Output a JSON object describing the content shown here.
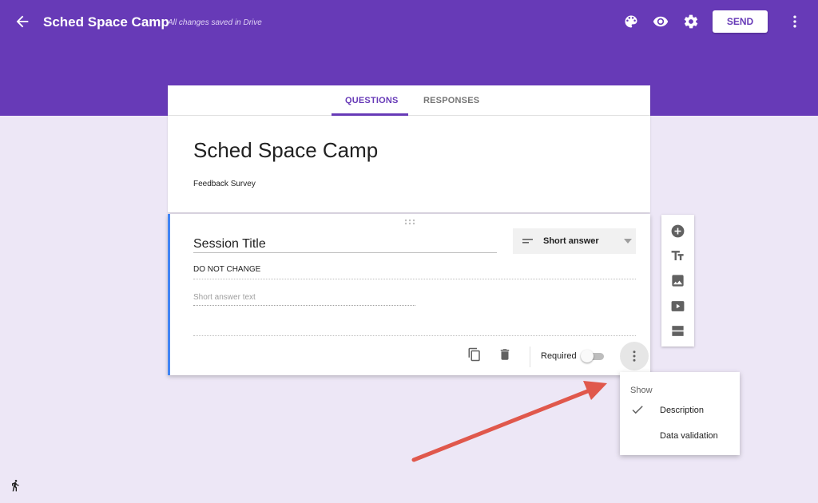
{
  "app": {
    "title": "Sched Space Camp",
    "save_status": "All changes saved in Drive",
    "send_label": "SEND"
  },
  "icons": {
    "back": "arrow-back-icon",
    "palette": "palette-icon",
    "preview": "eye-icon",
    "settings": "gear-icon",
    "more": "more-vert-icon"
  },
  "tabs": [
    {
      "label": "QUESTIONS",
      "active": true
    },
    {
      "label": "RESPONSES",
      "active": false
    }
  ],
  "form": {
    "title": "Sched Space Camp",
    "description": "Feedback Survey"
  },
  "question": {
    "title": "Session Title",
    "type": "Short answer",
    "description": "DO NOT CHANGE",
    "answer_placeholder": "Short answer text",
    "required_label": "Required",
    "required": false
  },
  "side_toolbar": [
    "add-question-icon",
    "add-title-icon",
    "add-image-icon",
    "add-video-icon",
    "add-section-icon"
  ],
  "menu": {
    "header": "Show",
    "items": [
      {
        "label": "Description",
        "checked": true
      },
      {
        "label": "Data validation",
        "checked": false
      }
    ]
  },
  "colors": {
    "accent": "#673ab7",
    "page_bg": "#ede7f6",
    "question_accent": "#4285f4",
    "annotation_arrow": "#e0584c"
  }
}
